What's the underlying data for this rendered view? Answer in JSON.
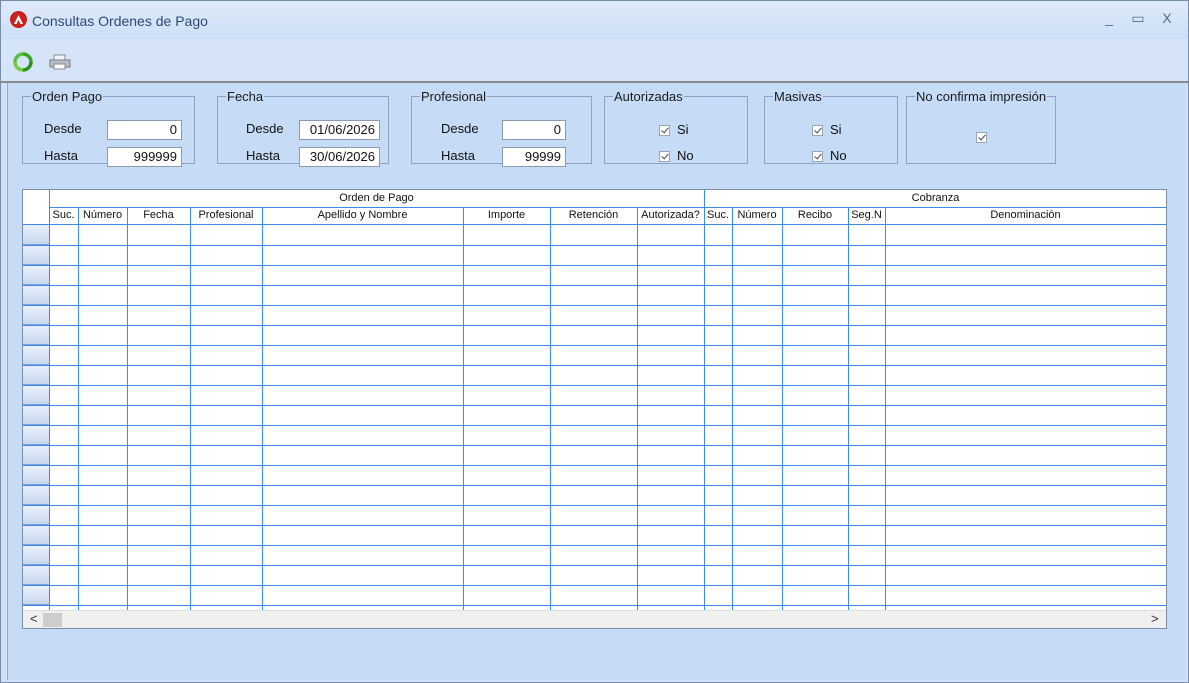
{
  "window": {
    "title": "Consultas Ordenes de Pago",
    "controls": {
      "minimize": "_",
      "maximize": "▭",
      "close": "X"
    }
  },
  "toolbar": {
    "refresh_icon": "refresh-icon",
    "print_icon": "printer-icon"
  },
  "filters": {
    "orden_pago": {
      "legend": "Orden Pago",
      "desde_label": "Desde",
      "desde_value": "0",
      "hasta_label": "Hasta",
      "hasta_value": "999999"
    },
    "fecha": {
      "legend": "Fecha",
      "desde_label": "Desde",
      "desde_value": "01/06/2026",
      "hasta_label": "Hasta",
      "hasta_value": "30/06/2026"
    },
    "profesional": {
      "legend": "Profesional",
      "desde_label": "Desde",
      "desde_value": "0",
      "hasta_label": "Hasta",
      "hasta_value": "99999"
    },
    "autorizadas": {
      "legend": "Autorizadas",
      "si_label": "Si",
      "si_checked": true,
      "no_label": "No",
      "no_checked": true
    },
    "masivas": {
      "legend": "Masivas",
      "si_label": "Si",
      "si_checked": true,
      "no_label": "No",
      "no_checked": true
    },
    "no_confirma": {
      "legend": "No confirma impresión",
      "checked": true
    }
  },
  "grid": {
    "group_orden": "Orden de Pago",
    "group_cobranza": "Cobranza",
    "columns": [
      "Suc.",
      "Número",
      "Fecha",
      "Profesional",
      "Apellido y Nombre",
      "Importe",
      "Retención",
      "Autorizada?",
      "Suc.",
      "Número",
      "Recibo",
      "Seg.N",
      "Denominación"
    ],
    "rows": 20,
    "scroll_left": "<",
    "scroll_right": ">"
  },
  "colors": {
    "grid_line": "#3d89f0",
    "background": "#c6dbf6",
    "accent_icon": "#c8211f"
  }
}
